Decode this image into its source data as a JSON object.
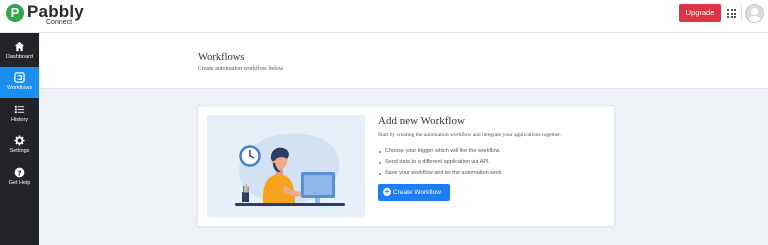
{
  "brand": {
    "logo_letter": "P",
    "name": "Pabbly",
    "product": "Connect",
    "color": "#2fa84f"
  },
  "topbar": {
    "upgrade_label": "Upgrade",
    "upgrade_color": "#dc3545"
  },
  "sidebar": {
    "items": [
      {
        "label": "Dashboard",
        "icon": "home-icon",
        "active": false
      },
      {
        "label": "Workflows",
        "icon": "workflow-icon",
        "active": true
      },
      {
        "label": "History",
        "icon": "history-icon",
        "active": false
      },
      {
        "label": "Settings",
        "icon": "gear-icon",
        "active": false
      },
      {
        "label": "Get Help",
        "icon": "help-icon",
        "active": false
      }
    ],
    "active_color": "#1b8ef2"
  },
  "header": {
    "title": "Workflows",
    "subtitle": "Create automation workflow below."
  },
  "card": {
    "title": "Add new Workflow",
    "description": "Start by creating the automation workflow and integrate your applications together.",
    "bullets": [
      "Choose your trigger which will fire the workflow.",
      "Send data to a different application via API.",
      "Save your workflow and let the automation work."
    ],
    "button_label": "Create Workflow",
    "button_icon": "plus-circle-icon",
    "button_color": "#1b7ef2"
  }
}
